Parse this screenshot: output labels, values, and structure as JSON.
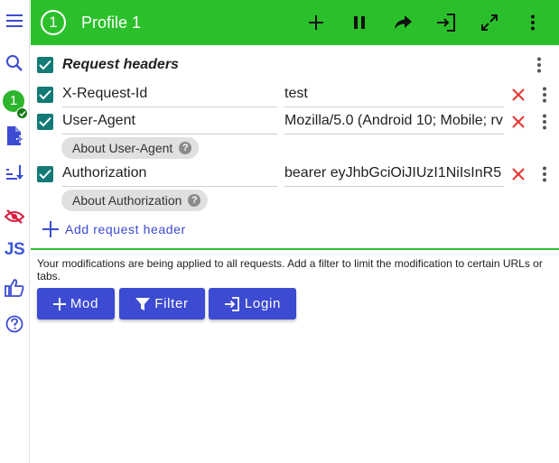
{
  "sidebar": {
    "profile_number": "1"
  },
  "header": {
    "profile_number": "1",
    "title": "Profile 1"
  },
  "request_headers": {
    "title": "Request headers",
    "rows": [
      {
        "name": "X-Request-Id",
        "value": "test"
      },
      {
        "name": "User-Agent",
        "value": "Mozilla/5.0 (Android 10; Mobile; rv",
        "about": "About User-Agent"
      },
      {
        "name": "Authorization",
        "value": "bearer eyJhbGciOiJIUzI1NiIsInR5",
        "about": "About Authorization"
      }
    ],
    "add_label": "Add request header"
  },
  "info_text": "Your modifications are being applied to all requests. Add a filter to limit the modification to certain URLs or tabs.",
  "actions": {
    "mod_label": "Mod",
    "filter_label": "Filter",
    "login_label": "Login"
  },
  "colors": {
    "header_green": "#2bc02b",
    "checkbox_teal": "#137a75",
    "accent_blue": "#3c4bd1",
    "delete_red": "#e53935"
  },
  "icons": {
    "sidebar": [
      "menu-icon",
      "search-icon",
      "profile-avatar",
      "add-file-icon",
      "sort-icon",
      "eye-off-icon",
      "js-icon",
      "thumb-up-icon",
      "help-icon"
    ],
    "header": [
      "add-icon",
      "pause-icon",
      "share-icon",
      "login-icon",
      "fullscreen-icon",
      "more-vert-icon"
    ]
  }
}
